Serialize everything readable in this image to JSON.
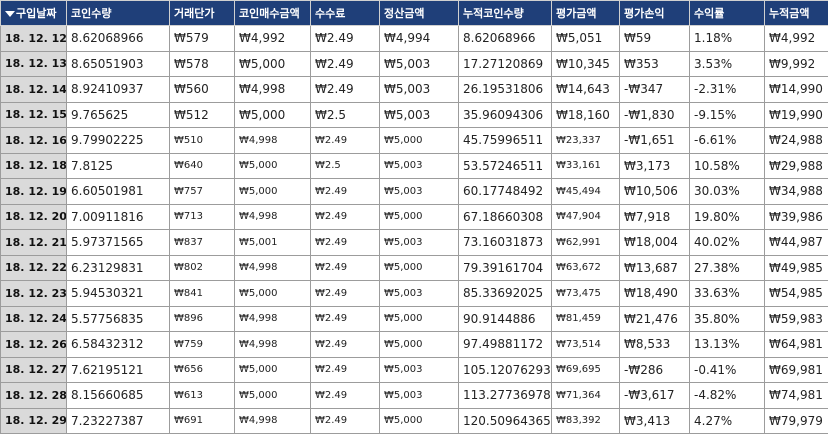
{
  "headers": {
    "date": "구입날짜",
    "coin_qty": "코인수량",
    "trade_price": "거래단가",
    "coin_buy_amount": "코인매수금액",
    "fee": "수수료",
    "settle_amount": "정산금액",
    "cum_coin_qty": "누적코인수량",
    "eval_amount": "평가금액",
    "eval_pl": "평가손익",
    "return_rate": "수익률",
    "cum_amount": "누적금액"
  },
  "rows": [
    {
      "date": "18. 12. 12.",
      "coin_qty": "8.62068966",
      "trade_price": "₩579",
      "coin_buy_amount": "₩4,992",
      "fee": "₩2.49",
      "settle_amount": "₩4,994",
      "cum_coin_qty": "8.62068966",
      "eval_amount": "₩5,051",
      "eval_pl": "₩59",
      "return_rate": "1.18%",
      "cum_amount": "₩4,992"
    },
    {
      "date": "18. 12. 13.",
      "coin_qty": "8.65051903",
      "trade_price": "₩578",
      "coin_buy_amount": "₩5,000",
      "fee": "₩2.49",
      "settle_amount": "₩5,003",
      "cum_coin_qty": "17.27120869",
      "eval_amount": "₩10,345",
      "eval_pl": "₩353",
      "return_rate": "3.53%",
      "cum_amount": "₩9,992"
    },
    {
      "date": "18. 12. 14.",
      "coin_qty": "8.92410937",
      "trade_price": "₩560",
      "coin_buy_amount": "₩4,998",
      "fee": "₩2.49",
      "settle_amount": "₩5,003",
      "cum_coin_qty": "26.19531806",
      "eval_amount": "₩14,643",
      "eval_pl": "-₩347",
      "return_rate": "-2.31%",
      "cum_amount": "₩14,990"
    },
    {
      "date": "18. 12. 15.",
      "coin_qty": "9.765625",
      "trade_price": "₩512",
      "coin_buy_amount": "₩5,000",
      "fee": "₩2.5",
      "settle_amount": "₩5,003",
      "cum_coin_qty": "35.96094306",
      "eval_amount": "₩18,160",
      "eval_pl": "-₩1,830",
      "return_rate": "-9.15%",
      "cum_amount": "₩19,990"
    },
    {
      "date": "18. 12. 16.",
      "coin_qty": "9.79902225",
      "trade_price": "₩510",
      "coin_buy_amount": "₩4,998",
      "fee": "₩2.49",
      "settle_amount": "₩5,000",
      "cum_coin_qty": "45.75996511",
      "eval_amount": "₩23,337",
      "eval_pl": "-₩1,651",
      "return_rate": "-6.61%",
      "cum_amount": "₩24,988"
    },
    {
      "date": "18. 12. 18.",
      "coin_qty": "7.8125",
      "trade_price": "₩640",
      "coin_buy_amount": "₩5,000",
      "fee": "₩2.5",
      "settle_amount": "₩5,003",
      "cum_coin_qty": "53.57246511",
      "eval_amount": "₩33,161",
      "eval_pl": "₩3,173",
      "return_rate": "10.58%",
      "cum_amount": "₩29,988"
    },
    {
      "date": "18. 12. 19.",
      "coin_qty": "6.60501981",
      "trade_price": "₩757",
      "coin_buy_amount": "₩5,000",
      "fee": "₩2.49",
      "settle_amount": "₩5,003",
      "cum_coin_qty": "60.17748492",
      "eval_amount": "₩45,494",
      "eval_pl": "₩10,506",
      "return_rate": "30.03%",
      "cum_amount": "₩34,988"
    },
    {
      "date": "18. 12. 20.",
      "coin_qty": "7.00911816",
      "trade_price": "₩713",
      "coin_buy_amount": "₩4,998",
      "fee": "₩2.49",
      "settle_amount": "₩5,000",
      "cum_coin_qty": "67.18660308",
      "eval_amount": "₩47,904",
      "eval_pl": "₩7,918",
      "return_rate": "19.80%",
      "cum_amount": "₩39,986"
    },
    {
      "date": "18. 12. 21.",
      "coin_qty": "5.97371565",
      "trade_price": "₩837",
      "coin_buy_amount": "₩5,001",
      "fee": "₩2.49",
      "settle_amount": "₩5,003",
      "cum_coin_qty": "73.16031873",
      "eval_amount": "₩62,991",
      "eval_pl": "₩18,004",
      "return_rate": "40.02%",
      "cum_amount": "₩44,987"
    },
    {
      "date": "18. 12. 22.",
      "coin_qty": "6.23129831",
      "trade_price": "₩802",
      "coin_buy_amount": "₩4,998",
      "fee": "₩2.49",
      "settle_amount": "₩5,000",
      "cum_coin_qty": "79.39161704",
      "eval_amount": "₩63,672",
      "eval_pl": "₩13,687",
      "return_rate": "27.38%",
      "cum_amount": "₩49,985"
    },
    {
      "date": "18. 12. 23.",
      "coin_qty": "5.94530321",
      "trade_price": "₩841",
      "coin_buy_amount": "₩5,000",
      "fee": "₩2.49",
      "settle_amount": "₩5,003",
      "cum_coin_qty": "85.33692025",
      "eval_amount": "₩73,475",
      "eval_pl": "₩18,490",
      "return_rate": "33.63%",
      "cum_amount": "₩54,985"
    },
    {
      "date": "18. 12. 24.",
      "coin_qty": "5.57756835",
      "trade_price": "₩896",
      "coin_buy_amount": "₩4,998",
      "fee": "₩2.49",
      "settle_amount": "₩5,000",
      "cum_coin_qty": "90.9144886",
      "eval_amount": "₩81,459",
      "eval_pl": "₩21,476",
      "return_rate": "35.80%",
      "cum_amount": "₩59,983"
    },
    {
      "date": "18. 12. 26.",
      "coin_qty": "6.58432312",
      "trade_price": "₩759",
      "coin_buy_amount": "₩4,998",
      "fee": "₩2.49",
      "settle_amount": "₩5,000",
      "cum_coin_qty": "97.49881172",
      "eval_amount": "₩73,514",
      "eval_pl": "₩8,533",
      "return_rate": "13.13%",
      "cum_amount": "₩64,981"
    },
    {
      "date": "18. 12. 27.",
      "coin_qty": "7.62195121",
      "trade_price": "₩656",
      "coin_buy_amount": "₩5,000",
      "fee": "₩2.49",
      "settle_amount": "₩5,003",
      "cum_coin_qty": "105.12076293",
      "eval_amount": "₩69,695",
      "eval_pl": "-₩286",
      "return_rate": "-0.41%",
      "cum_amount": "₩69,981"
    },
    {
      "date": "18. 12. 28.",
      "coin_qty": "8.15660685",
      "trade_price": "₩613",
      "coin_buy_amount": "₩5,000",
      "fee": "₩2.49",
      "settle_amount": "₩5,003",
      "cum_coin_qty": "113.27736978",
      "eval_amount": "₩71,364",
      "eval_pl": "-₩3,617",
      "return_rate": "-4.82%",
      "cum_amount": "₩74,981"
    },
    {
      "date": "18. 12. 29.",
      "coin_qty": "7.23227387",
      "trade_price": "₩691",
      "coin_buy_amount": "₩4,998",
      "fee": "₩2.49",
      "settle_amount": "₩5,000",
      "cum_coin_qty": "120.50964365",
      "eval_amount": "₩83,392",
      "eval_pl": "₩3,413",
      "return_rate": "4.27%",
      "cum_amount": "₩79,979"
    }
  ],
  "colors": {
    "header_bg": "#1f3f79",
    "header_text": "#ffffff",
    "date_bg": "#dadada",
    "grid": "#9c9c9c"
  },
  "icons": {
    "header_corner": "filter-dropdown-icon"
  }
}
